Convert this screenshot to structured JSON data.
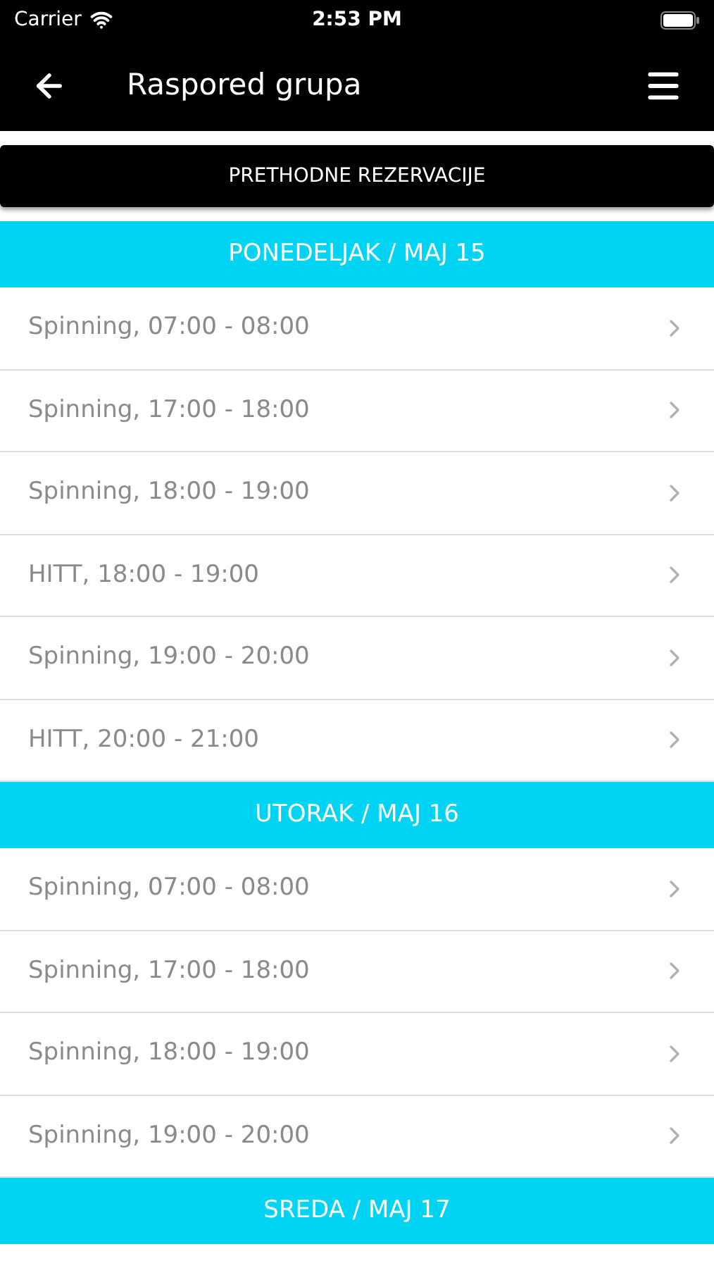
{
  "status_bar": {
    "carrier": "Carrier",
    "time": "2:53 PM"
  },
  "nav_bar": {
    "title": "Raspored grupa"
  },
  "previous_button": "PRETHODNE REZERVACIJE",
  "days": [
    {
      "header": "PONEDELJAK / MAJ 15",
      "sessions": [
        "Spinning, 07:00 - 08:00",
        "Spinning, 17:00 - 18:00",
        "Spinning, 18:00 - 19:00",
        "HITT, 18:00 - 19:00",
        "Spinning, 19:00 - 20:00",
        "HITT, 20:00 - 21:00"
      ]
    },
    {
      "header": "UTORAK / MAJ 16",
      "sessions": [
        "Spinning, 07:00 - 08:00",
        "Spinning, 17:00 - 18:00",
        "Spinning, 18:00 - 19:00",
        "Spinning, 19:00 - 20:00"
      ]
    },
    {
      "header": "SREDA / MAJ 17"
    }
  ]
}
